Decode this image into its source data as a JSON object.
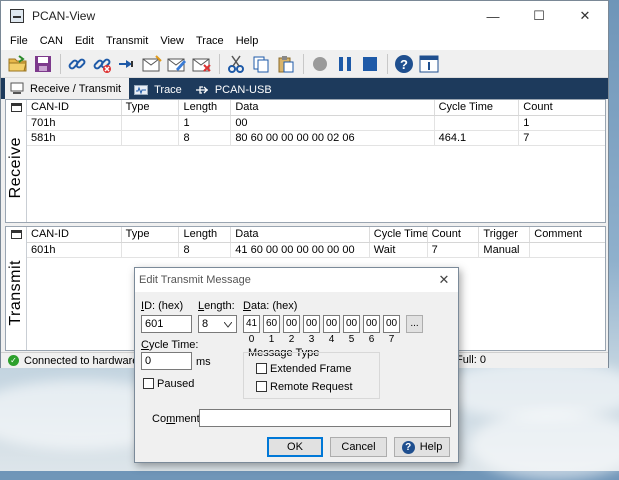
{
  "window": {
    "title": "PCAN-View",
    "min": "—",
    "max": "☐",
    "close": "✕"
  },
  "menu": [
    "File",
    "CAN",
    "Edit",
    "Transmit",
    "View",
    "Trace",
    "Help"
  ],
  "tabs": [
    {
      "label": "Receive / Transmit",
      "active": true
    },
    {
      "label": "Trace",
      "active": false
    },
    {
      "label": "PCAN-USB",
      "active": false
    }
  ],
  "receive": {
    "side_label": "Receive",
    "columns": [
      "CAN-ID",
      "Type",
      "Length",
      "Data",
      "Cycle Time",
      "Count"
    ],
    "rows": [
      [
        "701h",
        "",
        "1",
        "00",
        "",
        "1"
      ],
      [
        "581h",
        "",
        "8",
        "80 60 00 00 00 00 02 06",
        "464.1",
        "7"
      ]
    ]
  },
  "transmit": {
    "side_label": "Transmit",
    "columns": [
      "CAN-ID",
      "Type",
      "Length",
      "Data",
      "Cycle Time",
      "Count",
      "Trigger",
      "Comment"
    ],
    "rows": [
      [
        "601h",
        "",
        "8",
        "41 60 00 00 00 00 00 00",
        "Wait",
        "7",
        "Manual",
        ""
      ]
    ]
  },
  "status": {
    "left": "Connected to hardware PCA",
    "right": "Full: 0"
  },
  "dialog": {
    "title": "Edit Transmit Message",
    "close": "✕",
    "id_label_key": "I",
    "id_label_rest": "D: (hex)",
    "id_value": "601",
    "length_label_key": "L",
    "length_label_rest": "ength:",
    "length_value": "8",
    "data_label_key": "D",
    "data_label_rest": "ata: (hex)",
    "data_bytes": [
      "41",
      "60",
      "00",
      "00",
      "00",
      "00",
      "00",
      "00"
    ],
    "byte_indices": [
      "0",
      "1",
      "2",
      "3",
      "4",
      "5",
      "6",
      "7"
    ],
    "more_button": "...",
    "cycle_label_key": "C",
    "cycle_label_rest": "ycle Time:",
    "cycle_value": "0",
    "cycle_unit": "ms",
    "paused_label": "Paused",
    "message_type_label": "Message Type",
    "extended_label": "Extended Frame",
    "remote_label": "Remote Request",
    "comment_label_pre": "Co",
    "comment_label_key": "m",
    "comment_label_post": "ment:",
    "comment_value": "",
    "ok": "OK",
    "cancel": "Cancel",
    "help": "Help"
  }
}
